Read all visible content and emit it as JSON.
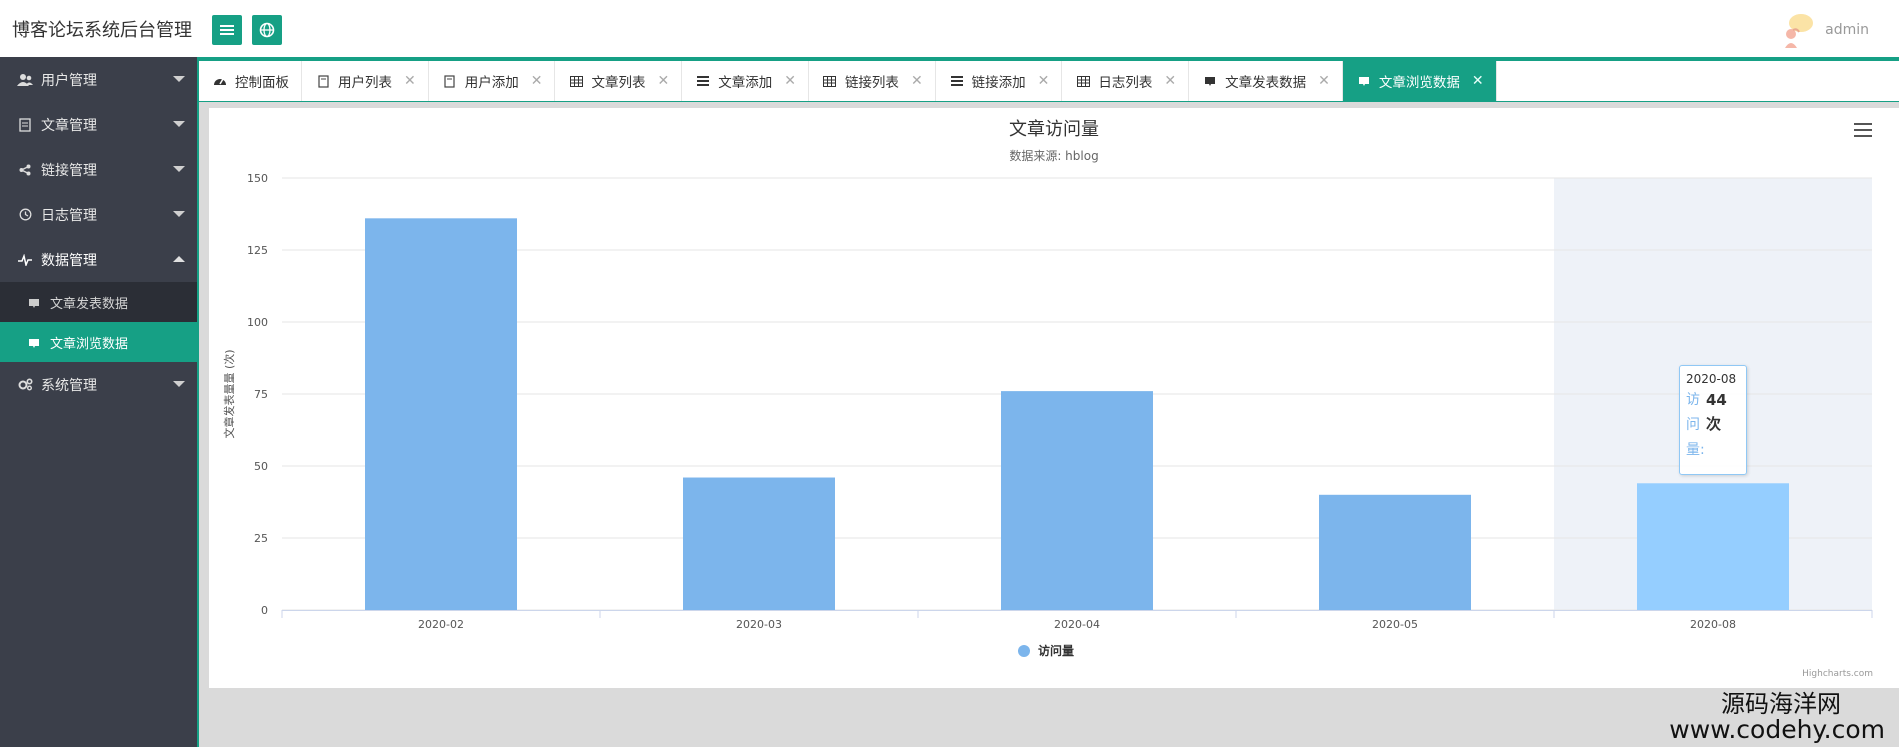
{
  "app": {
    "title": "博客论坛系统后台管理",
    "user": "admin"
  },
  "colors": {
    "accent": "#16a085",
    "sidebar": "#3b3f4a",
    "bar": "#7cb5ec",
    "bar_hover": "#95ceff"
  },
  "header": {
    "menu_icon": "hamburger-icon",
    "globe_icon": "globe-icon"
  },
  "sidebar": {
    "items": [
      {
        "label": "用户管理",
        "icon": "users-icon"
      },
      {
        "label": "文章管理",
        "icon": "document-icon"
      },
      {
        "label": "链接管理",
        "icon": "share-icon"
      },
      {
        "label": "日志管理",
        "icon": "history-icon"
      },
      {
        "label": "数据管理",
        "icon": "pulse-icon"
      },
      {
        "label": "系统管理",
        "icon": "cogs-icon"
      }
    ],
    "sub_items": [
      {
        "label": "文章发表数据"
      },
      {
        "label": "文章浏览数据"
      }
    ]
  },
  "tabs": [
    {
      "label": "控制面板",
      "icon": "dashboard-icon"
    },
    {
      "label": "用户列表",
      "icon": "file-icon"
    },
    {
      "label": "用户添加",
      "icon": "file-icon"
    },
    {
      "label": "文章列表",
      "icon": "table-icon"
    },
    {
      "label": "文章添加",
      "icon": "list-icon"
    },
    {
      "label": "链接列表",
      "icon": "table-icon"
    },
    {
      "label": "链接添加",
      "icon": "list-icon"
    },
    {
      "label": "日志列表",
      "icon": "table-icon"
    },
    {
      "label": "文章发表数据",
      "icon": "chart-icon"
    },
    {
      "label": "文章浏览数据",
      "icon": "chart-icon"
    }
  ],
  "chart_data": {
    "type": "bar",
    "title": "文章访问量",
    "subtitle": "数据来源: hblog",
    "ylabel": "文章发表量量 (次)",
    "xlabel": "",
    "categories": [
      "2020-02",
      "2020-03",
      "2020-04",
      "2020-05",
      "2020-08"
    ],
    "series": [
      {
        "name": "访问量",
        "values": [
          136,
          46,
          76,
          40,
          44
        ]
      }
    ],
    "ylim": [
      0,
      150
    ],
    "yticks": [
      "0",
      "25",
      "50",
      "75",
      "100",
      "125",
      "150"
    ],
    "grid": true,
    "legend": "bottom-center",
    "highlighted_category": "2020-08",
    "tooltip": {
      "category": "2020-08",
      "series": "访问量:",
      "value": "44 次"
    },
    "credits": "Highcharts.com"
  },
  "watermark": {
    "line1": "源码海洋网",
    "line2": "www.codehy.com"
  }
}
